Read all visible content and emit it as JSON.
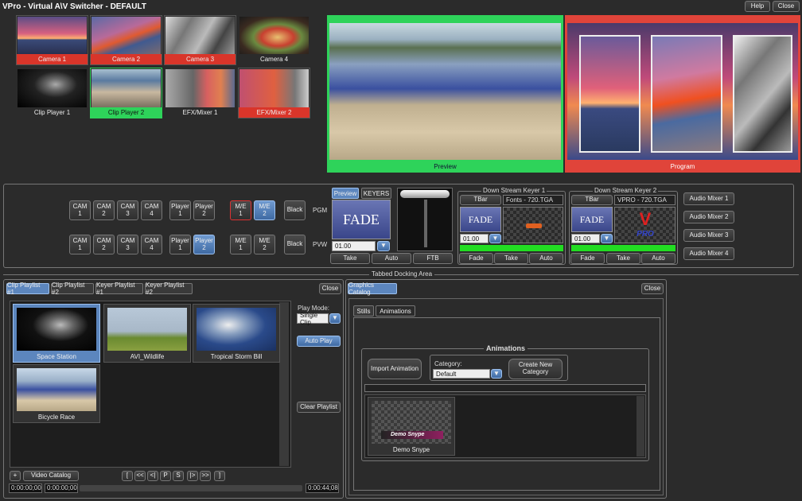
{
  "window": {
    "title": "VPro - Virtual A\\V Switcher - DEFAULT",
    "help_label": "Help",
    "close_label": "Close"
  },
  "sources": [
    {
      "label": "Camera 1",
      "state": "program"
    },
    {
      "label": "Camera 2",
      "state": "program"
    },
    {
      "label": "Camera 3",
      "state": "program"
    },
    {
      "label": "Camera 4",
      "state": "none"
    },
    {
      "label": "Clip Player 1",
      "state": "none"
    },
    {
      "label": "Clip Player 2",
      "state": "preview"
    },
    {
      "label": "EFX/Mixer 1",
      "state": "none"
    },
    {
      "label": "EFX/Mixer 2",
      "state": "program"
    }
  ],
  "monitors": {
    "preview_label": "Preview",
    "program_label": "Program"
  },
  "switcher": {
    "pgm_label": "PGM",
    "pvw_label": "PVW",
    "pgm_row": [
      {
        "top": "CAM",
        "bottom": "1"
      },
      {
        "top": "CAM",
        "bottom": "2"
      },
      {
        "top": "CAM",
        "bottom": "3"
      },
      {
        "top": "CAM",
        "bottom": "4"
      },
      {
        "top": "Player",
        "bottom": "1"
      },
      {
        "top": "Player",
        "bottom": "2"
      },
      {
        "top": "M/E",
        "bottom": "1"
      },
      {
        "top": "M/E",
        "bottom": "2"
      }
    ],
    "pvw_row": [
      {
        "top": "CAM",
        "bottom": "1"
      },
      {
        "top": "CAM",
        "bottom": "2"
      },
      {
        "top": "CAM",
        "bottom": "3"
      },
      {
        "top": "CAM",
        "bottom": "4"
      },
      {
        "top": "Player",
        "bottom": "1"
      },
      {
        "top": "Player",
        "bottom": "2"
      },
      {
        "top": "M/E",
        "bottom": "1"
      },
      {
        "top": "M/E",
        "bottom": "2"
      }
    ],
    "black_label": "Black",
    "preview_tab": "Preview",
    "keyers_tab": "KEYERS",
    "transition_graphic": "FADE",
    "duration": "01.00",
    "take_label": "Take",
    "auto_label": "Auto",
    "ftb_label": "FTB"
  },
  "dsk1": {
    "title": "Down Stream Keyer 1",
    "tbar_label": "TBar",
    "file": "Fonts - 720.TGA",
    "graphic": "FADE",
    "duration": "01.00",
    "fade_label": "Fade",
    "take_label": "Take",
    "auto_label": "Auto"
  },
  "dsk2": {
    "title": "Down Stream Keyer 2",
    "tbar_label": "TBar",
    "file": "VPRO - 720.TGA",
    "graphic": "FADE",
    "duration": "01.00",
    "logo_text": "PRO",
    "fade_label": "Fade",
    "take_label": "Take",
    "auto_label": "Auto"
  },
  "audio_mixers": [
    "Audio Mixer 1",
    "Audio Mixer 2",
    "Audio Mixer 3",
    "Audio Mixer 4"
  ],
  "docking": {
    "title": "Tabbed Docking Area"
  },
  "playlist": {
    "tabs": [
      "Clip Playlist #1",
      "Clip Playlist #2",
      "Keyer Playlist #1",
      "Keyer Playlist #2"
    ],
    "close_label": "Close",
    "clips": [
      {
        "label": "Space Station",
        "selected": true
      },
      {
        "label": "AVI_Wildlife",
        "selected": false
      },
      {
        "label": "Tropical Storm Bill",
        "selected": false
      },
      {
        "label": "Bicycle Race",
        "selected": false
      }
    ],
    "play_mode_label": "Play Mode:",
    "play_mode_value": "Single Clip",
    "auto_play_label": "Auto Play",
    "clear_label": "Clear Playlist",
    "add_label": "+",
    "video_catalog_label": "Video Catalog",
    "transport": [
      "[",
      "<<",
      "<|",
      "P",
      "S",
      "|>",
      ">>",
      "]"
    ],
    "time_current": "0:00:00;00",
    "time_in": "0:00:00;00",
    "time_duration": "0:00:44;08"
  },
  "graphics": {
    "tab_label": "Graphics Catalog",
    "close_label": "Close",
    "subtabs": [
      "Stills",
      "Animations"
    ],
    "group_title": "Animations",
    "import_label": "Import Animation",
    "category_label": "Category:",
    "category_value": "Default",
    "create_label": "Create New Category",
    "item_label": "Demo Snype",
    "item_graphic": "Demo Snype"
  }
}
